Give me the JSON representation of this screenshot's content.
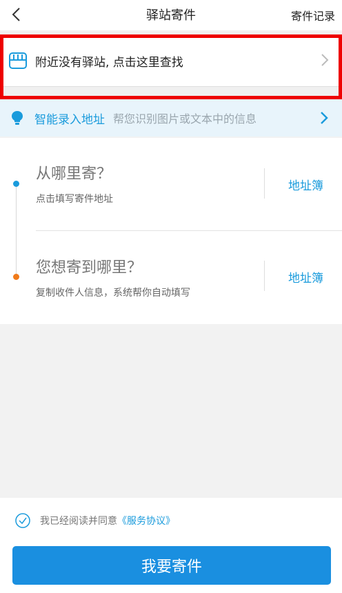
{
  "header": {
    "title": "驿站寄件",
    "right_label": "寄件记录"
  },
  "station": {
    "text": "附近没有驿站, 点击这里查找"
  },
  "smart_input": {
    "title": "智能录入地址",
    "desc": "帮您识别图片或文本中的信息"
  },
  "sender": {
    "title": "从哪里寄？",
    "subtitle": "点击填写寄件地址",
    "book_label": "地址簿"
  },
  "receiver": {
    "title": "您想寄到哪里？",
    "subtitle": "复制收件人信息，系统帮你自动填写",
    "book_label": "地址簿"
  },
  "agreement": {
    "text": "我已经阅读并同意",
    "link": "《服务协议》"
  },
  "submit": {
    "label": "我要寄件"
  },
  "colors": {
    "accent": "#1a9bdc",
    "button": "#1a8fe0",
    "highlight_border": "#ee0000",
    "orange_dot": "#f07a1a"
  }
}
